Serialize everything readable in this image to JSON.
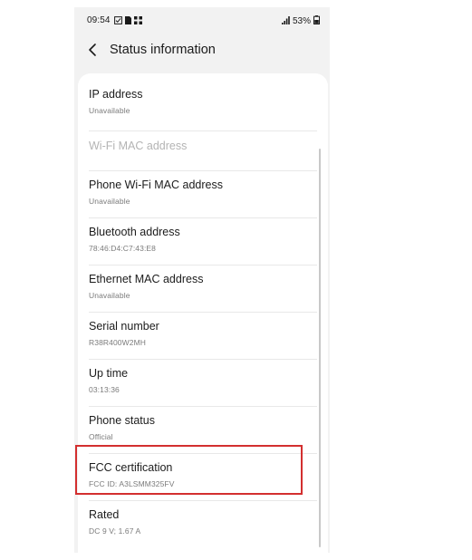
{
  "status_bar": {
    "time": "09:54",
    "icons_left": [
      "check-box-icon",
      "sim-card-icon",
      "grid-apps-icon"
    ],
    "signal_icon": "signal-icon",
    "battery_percent": "53%",
    "battery_icon": "battery-icon"
  },
  "header": {
    "back_icon": "back-arrow-icon",
    "title": "Status information"
  },
  "items": [
    {
      "title": "IP address",
      "subtitle": "Unavailable",
      "enabled": true
    },
    {
      "title": "Wi-Fi MAC address",
      "subtitle": "",
      "enabled": false
    },
    {
      "title": "Phone Wi-Fi MAC address",
      "subtitle": "Unavailable",
      "enabled": true
    },
    {
      "title": "Bluetooth address",
      "subtitle": "78:46:D4:C7:43:E8",
      "enabled": true
    },
    {
      "title": "Ethernet MAC address",
      "subtitle": "Unavailable",
      "enabled": true
    },
    {
      "title": "Serial number",
      "subtitle": "R38R400W2MH",
      "enabled": true
    },
    {
      "title": "Up time",
      "subtitle": "03:13:36",
      "enabled": true
    },
    {
      "title": "Phone status",
      "subtitle": "Official",
      "enabled": true
    },
    {
      "title": "FCC certification",
      "subtitle": "FCC ID: A3LSMM325FV",
      "enabled": true
    },
    {
      "title": "Rated",
      "subtitle": "DC 9 V; 1.67 A",
      "enabled": true
    }
  ],
  "highlight": {
    "color": "#d32f2f",
    "target": "FCC certification"
  }
}
